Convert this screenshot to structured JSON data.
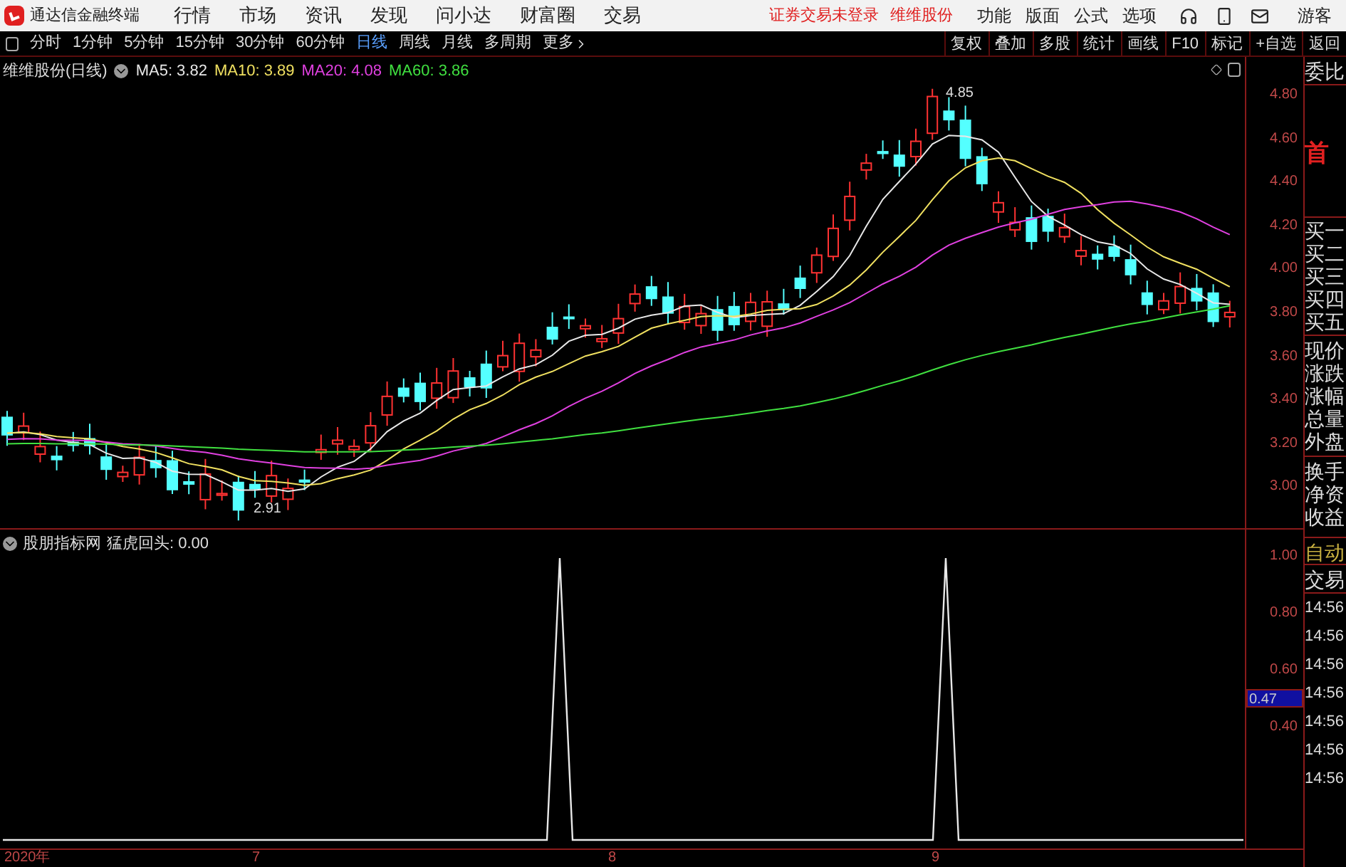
{
  "app": {
    "title": "通达信金融终端"
  },
  "menu": [
    "行情",
    "市场",
    "资讯",
    "发现",
    "问小达",
    "财富圈",
    "交易"
  ],
  "login_status": "证券交易未登录",
  "stock_link": "维维股份",
  "top_right": [
    "功能",
    "版面",
    "公式",
    "选项"
  ],
  "guest": "游客",
  "periods": [
    {
      "label": "分时",
      "selected": false
    },
    {
      "label": "1分钟",
      "selected": false
    },
    {
      "label": "5分钟",
      "selected": false
    },
    {
      "label": "15分钟",
      "selected": false
    },
    {
      "label": "30分钟",
      "selected": false
    },
    {
      "label": "60分钟",
      "selected": false
    },
    {
      "label": "日线",
      "selected": true
    },
    {
      "label": "周线",
      "selected": false
    },
    {
      "label": "月线",
      "selected": false
    },
    {
      "label": "多周期",
      "selected": false
    }
  ],
  "more": "更多",
  "tools": [
    "复权",
    "叠加",
    "多股",
    "统计",
    "画线",
    "F10",
    "标记",
    "+自选",
    "返回"
  ],
  "chart": {
    "title": "维维股份(日线)",
    "ma": [
      {
        "label": "MA5: 3.82",
        "color": "#e8e8e8"
      },
      {
        "label": "MA10: 3.89",
        "color": "#f0e060"
      },
      {
        "label": "MA20: 4.08",
        "color": "#e040e0"
      },
      {
        "label": "MA60: 3.86",
        "color": "#40e040"
      }
    ],
    "high_label": "4.85",
    "low_label": "2.91",
    "price_ticks": [
      "4.80",
      "4.60",
      "4.40",
      "4.20",
      "4.00",
      "3.80",
      "3.60",
      "3.40",
      "3.20",
      "3.00"
    ]
  },
  "indicator": {
    "source": "股朋指标网",
    "name": "猛虎回头: 0.00",
    "ticks": [
      "1.00",
      "0.80",
      "0.60",
      "0.40"
    ],
    "cursor_value": "0.47"
  },
  "x_axis": [
    "2020年",
    "7",
    "8",
    "9"
  ],
  "quote_panel": {
    "ratio": "委比",
    "board": "首",
    "bids": [
      "买一",
      "买二",
      "买三",
      "买四",
      "买五"
    ],
    "stats": [
      "现价",
      "涨跌",
      "涨幅",
      "总量",
      "外盘"
    ],
    "extra": [
      "换手",
      "净资",
      "收益"
    ],
    "auto": "自动",
    "trade_header": "交易",
    "trades": [
      "14:56",
      "14:56",
      "14:56",
      "14:56",
      "14:56",
      "14:56",
      "14:56"
    ]
  }
}
